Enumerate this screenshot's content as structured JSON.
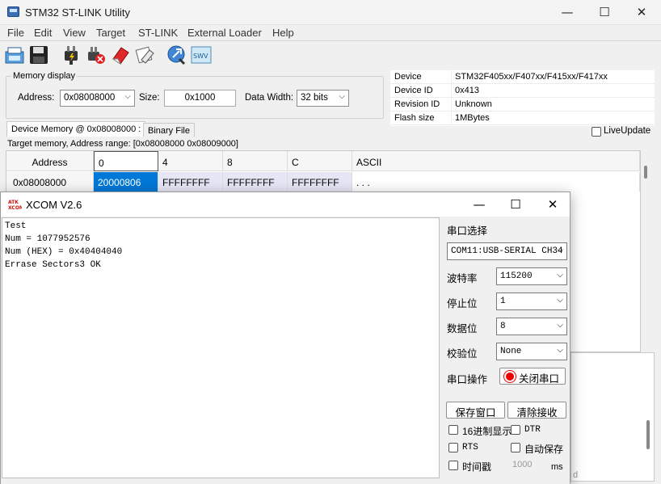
{
  "stlink": {
    "title": "STM32 ST-LINK Utility",
    "menu": [
      "File",
      "Edit",
      "View",
      "Target",
      "ST-LINK",
      "External Loader",
      "Help"
    ],
    "toolbar_icons": [
      "save-file-icon",
      "save-disk-icon",
      "connect-icon",
      "disconnect-icon",
      "erase-icon",
      "erase-sectors-icon",
      "program-icon",
      "swv-icon"
    ],
    "memory_display": {
      "title": "Memory display",
      "address_label": "Address:",
      "address_value": "0x08008000",
      "size_label": "Size:",
      "size_value": "0x1000",
      "width_label": "Data Width:",
      "width_value": "32 bits"
    },
    "device_info": [
      {
        "key": "Device",
        "value": "STM32F405xx/F407xx/F415xx/F417xx"
      },
      {
        "key": "Device ID",
        "value": "0x413"
      },
      {
        "key": "Revision ID",
        "value": "Unknown"
      },
      {
        "key": "Flash size",
        "value": "1MBytes"
      }
    ],
    "tabs": [
      "Device Memory @ 0x08008000 :",
      "Binary File"
    ],
    "live_update": "LiveUpdate",
    "range_label": "Target memory, Address range: [0x08008000 0x08009000]",
    "grid": {
      "headers": [
        "Address",
        "0",
        "4",
        "8",
        "C",
        "ASCII"
      ],
      "row": [
        "0x08008000",
        "20000806",
        "FFFFFFFF",
        "FFFFFFFF",
        "FFFFFFFF",
        ". . ."
      ]
    },
    "lower_panel_fragment": "d"
  },
  "xcom": {
    "title": "XCOM V2.6",
    "icon_text": "ATK",
    "receive_lines": [
      "Test",
      "Num = 1077952576",
      "Num (HEX) = 0x40404040",
      "Errase Sectors3 OK"
    ],
    "port_label": "串口选择",
    "port_value": "COM11:USB-SERIAL CH34",
    "baud_label": "波特率",
    "baud_value": "115200",
    "stop_label": "停止位",
    "stop_value": "1",
    "data_label": "数据位",
    "data_value": "8",
    "parity_label": "校验位",
    "parity_value": "None",
    "op_label": "串口操作",
    "close_port": "关闭串口",
    "save_window": "保存窗口",
    "clear_recv": "清除接收",
    "hex_display": "16进制显示",
    "dtr": "DTR",
    "rts": "RTS",
    "auto_save": "自动保存",
    "timestamp": "时间戳",
    "interval": "1000",
    "interval_unit": "ms"
  },
  "colors": {
    "selection": "#0078d7",
    "grid_row": "#e6e6f5"
  }
}
